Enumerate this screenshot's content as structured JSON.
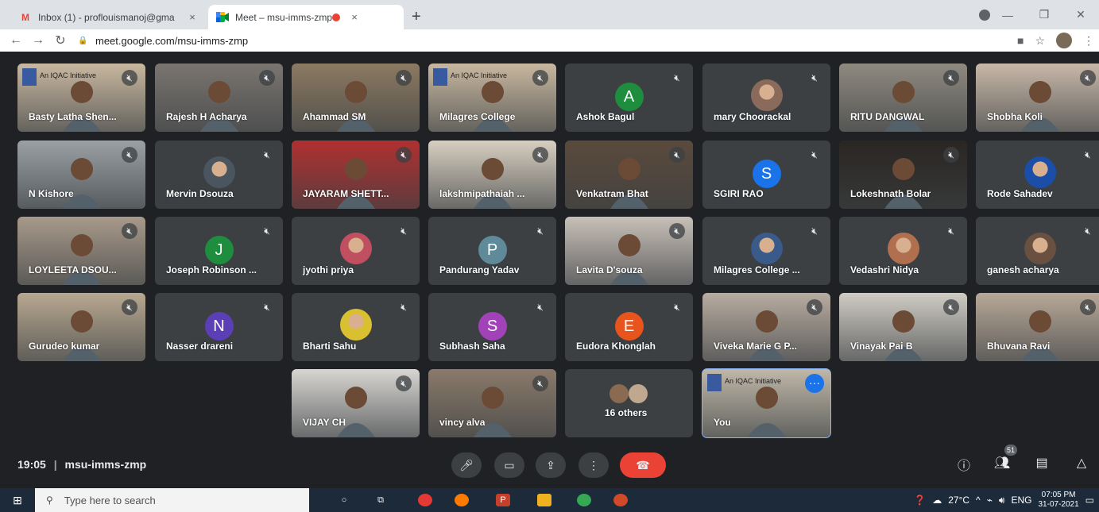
{
  "browser": {
    "tabs": [
      {
        "favicon": "gmail-icon",
        "title": "Inbox (1) - proflouismanoj@gma",
        "close": "×"
      },
      {
        "favicon": "meet-icon",
        "title": "Meet – msu-imms-zmp",
        "close": "×"
      }
    ],
    "new_tab": "+",
    "window_controls": {
      "minimize": "—",
      "restore": "❐",
      "close": "✕"
    },
    "url": "meet.google.com/msu-imms-zmp"
  },
  "meeting": {
    "time": "19:05",
    "separator": "|",
    "code": "msu-imms-zmp",
    "participant_count": "51",
    "tiles": [
      {
        "name": "Basty Latha Shen...",
        "kind": "video",
        "tint": "#c9b8a0",
        "banner": "An IQAC Initiative"
      },
      {
        "name": "Rajesh H Acharya",
        "kind": "video",
        "tint": "#7a7570"
      },
      {
        "name": "Ahammad SM",
        "kind": "video",
        "tint": "#8c7a62"
      },
      {
        "name": "Milagres College",
        "kind": "video",
        "tint": "#c9b8a0",
        "banner": "An IQAC Initiative"
      },
      {
        "name": "Ashok Bagul",
        "kind": "letter",
        "letter": "A",
        "color": "#1e8e3e"
      },
      {
        "name": "mary Choorackal",
        "kind": "photo",
        "color": "#8a6a5a"
      },
      {
        "name": "RITU DANGWAL",
        "kind": "video",
        "tint": "#8f8a80"
      },
      {
        "name": "Shobha Koli",
        "kind": "video",
        "tint": "#c8b8a8"
      },
      {
        "name": "N Kishore",
        "kind": "video",
        "tint": "#9aa0a4"
      },
      {
        "name": "Mervin Dsouza",
        "kind": "photo",
        "color": "#4a5560"
      },
      {
        "name": "JAYARAM SHETT...",
        "kind": "video",
        "tint": "#b03030"
      },
      {
        "name": "lakshmipathaiah ...",
        "kind": "video",
        "tint": "#d8cfc0"
      },
      {
        "name": "Venkatram Bhat",
        "kind": "video",
        "tint": "#5a4a3c"
      },
      {
        "name": "SGIRI RAO",
        "kind": "letter",
        "letter": "S",
        "color": "#1a73e8"
      },
      {
        "name": "Lokeshnath Bolar",
        "kind": "video",
        "tint": "#2a2622"
      },
      {
        "name": "Rode Sahadev",
        "kind": "photo",
        "color": "#1a4ea8"
      },
      {
        "name": "LOYLEETA DSOU...",
        "kind": "video",
        "tint": "#a89a8a"
      },
      {
        "name": "Joseph Robinson ...",
        "kind": "letter",
        "letter": "J",
        "color": "#1e8e3e"
      },
      {
        "name": "jyothi priya",
        "kind": "photo",
        "color": "#c05060"
      },
      {
        "name": "Pandurang Yadav",
        "kind": "letter",
        "letter": "P",
        "color": "#5f8a9a"
      },
      {
        "name": "Lavita D'souza",
        "kind": "video",
        "tint": "#c8c0b8"
      },
      {
        "name": "Milagres College ...",
        "kind": "photo",
        "color": "#3a5a8a"
      },
      {
        "name": "Vedashri Nidya",
        "kind": "photo",
        "color": "#b07050"
      },
      {
        "name": "ganesh acharya",
        "kind": "photo",
        "color": "#6a5040"
      },
      {
        "name": "Gurudeo kumar",
        "kind": "video",
        "tint": "#b8a890"
      },
      {
        "name": "Nasser drareni",
        "kind": "letter",
        "letter": "N",
        "color": "#5b3fb6"
      },
      {
        "name": "Bharti Sahu",
        "kind": "photo",
        "color": "#d8c030"
      },
      {
        "name": "Subhash Saha",
        "kind": "letter",
        "letter": "S",
        "color": "#a142b8"
      },
      {
        "name": "Eudora Khonglah",
        "kind": "letter",
        "letter": "E",
        "color": "#e8541c"
      },
      {
        "name": "Viveka Marie G P...",
        "kind": "video",
        "tint": "#b8aca0"
      },
      {
        "name": "Vinayak Pai B",
        "kind": "video",
        "tint": "#d0ccc4"
      },
      {
        "name": "Bhuvana Ravi",
        "kind": "video",
        "tint": "#b8a898"
      },
      {
        "name": "VIJAY CH",
        "kind": "video",
        "tint": "#d8d6d2"
      },
      {
        "name": "vincy alva",
        "kind": "video",
        "tint": "#8a7a6a"
      },
      {
        "name": "16 others",
        "kind": "others"
      },
      {
        "name": "You",
        "kind": "video",
        "tint": "#c0b8a8",
        "banner": "An IQAC Initiative"
      }
    ]
  },
  "taskbar": {
    "search_placeholder": "Type here to search",
    "temperature": "27°C",
    "language": "ENG",
    "time": "07:05 PM",
    "date": "31-07-2021"
  }
}
